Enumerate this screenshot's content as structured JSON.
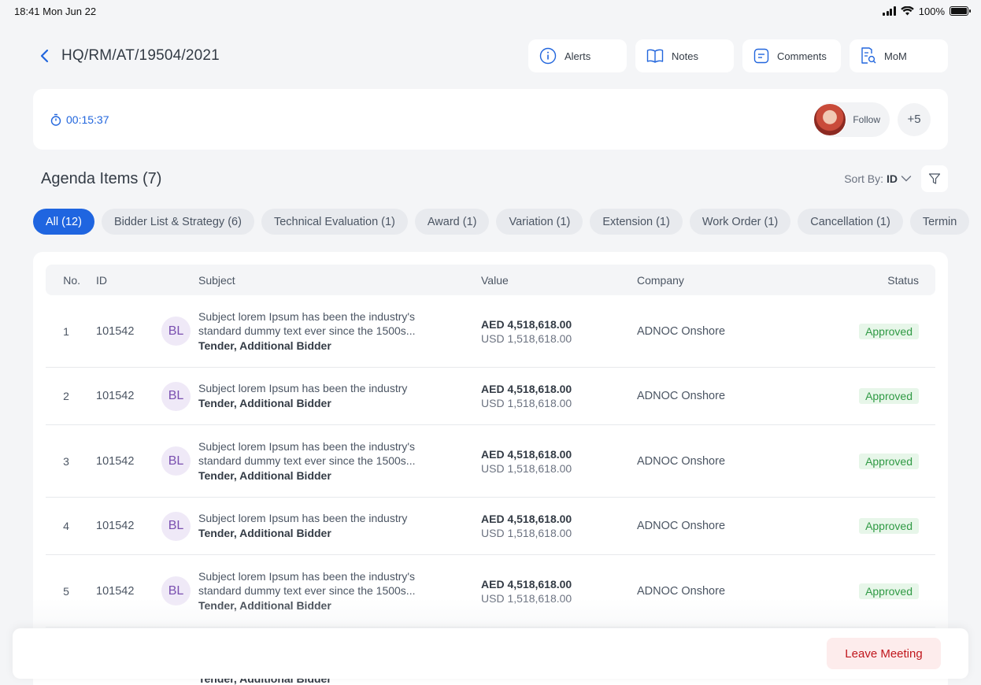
{
  "status_bar": {
    "time": "18:41 Mon Jun 22",
    "battery": "100%"
  },
  "header": {
    "title": "HQ/RM/AT/19504/2021",
    "actions": [
      {
        "label": "Alerts",
        "icon": "info-icon"
      },
      {
        "label": "Notes",
        "icon": "book-icon"
      },
      {
        "label": "Comments",
        "icon": "comment-icon"
      },
      {
        "label": "MoM",
        "icon": "document-search-icon"
      }
    ]
  },
  "meeting": {
    "timer": "00:15:37",
    "follow_label": "Follow",
    "more_participants": "+5"
  },
  "agenda": {
    "title": "Agenda Items (7)",
    "sort_label": "Sort By:",
    "sort_value": "ID",
    "tabs": [
      "All (12)",
      "Bidder List & Strategy (6)",
      "Technical Evaluation (1)",
      "Award (1)",
      "Variation (1)",
      "Extension (1)",
      "Work Order (1)",
      "Cancellation (1)",
      "Termin"
    ]
  },
  "table": {
    "columns": {
      "no": "No.",
      "id": "ID",
      "subject": "Subject",
      "value": "Value",
      "company": "Company",
      "status": "Status"
    },
    "rows": [
      {
        "no": "1",
        "id": "101542",
        "initials": "BL",
        "subject": [
          "Subject lorem Ipsum has been the industry's",
          "standard dummy text ever since the 1500s..."
        ],
        "tag": "Tender, Additional Bidder",
        "aed": "AED 4,518,618.00",
        "usd": "USD 1,518,618.00",
        "company": "ADNOC Onshore",
        "status": "Approved"
      },
      {
        "no": "2",
        "id": "101542",
        "initials": "BL",
        "subject": [
          "Subject lorem Ipsum has been the industry"
        ],
        "tag": "Tender, Additional Bidder",
        "aed": "AED 4,518,618.00",
        "usd": "USD 1,518,618.00",
        "company": "ADNOC Onshore",
        "status": "Approved"
      },
      {
        "no": "3",
        "id": "101542",
        "initials": "BL",
        "subject": [
          "Subject lorem Ipsum has been the industry's",
          "standard dummy text ever since the 1500s..."
        ],
        "tag": "Tender, Additional Bidder",
        "aed": "AED 4,518,618.00",
        "usd": "USD 1,518,618.00",
        "company": "ADNOC Onshore",
        "status": "Approved"
      },
      {
        "no": "4",
        "id": "101542",
        "initials": "BL",
        "subject": [
          "Subject lorem Ipsum has been the industry"
        ],
        "tag": "Tender, Additional Bidder",
        "aed": "AED 4,518,618.00",
        "usd": "USD 1,518,618.00",
        "company": "ADNOC Onshore",
        "status": "Approved"
      },
      {
        "no": "5",
        "id": "101542",
        "initials": "BL",
        "subject": [
          "Subject lorem Ipsum has been the industry's",
          "standard dummy text ever since the 1500s..."
        ],
        "tag": "Tender, Additional Bidder",
        "aed": "AED 4,518,618.00",
        "usd": "USD 1,518,618.00",
        "company": "ADNOC Onshore",
        "status": "Approved"
      }
    ],
    "peek_tag": "Tender, Additional Bidder"
  },
  "footer": {
    "leave_label": "Leave Meeting"
  },
  "colors": {
    "accent": "#1f65e0",
    "approved": "#2f9a44",
    "danger": "#c0161c"
  }
}
